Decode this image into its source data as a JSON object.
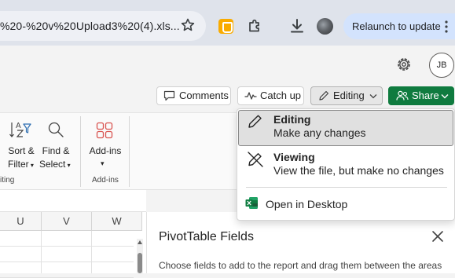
{
  "browser": {
    "address_text": "%20-%20v%20Upload3%20(4).xls...",
    "relaunch_label": "Relaunch to update",
    "icons": [
      "star-icon",
      "extension-icon",
      "puzzle-icon",
      "download-icon",
      "profile-avatar",
      "more-icon"
    ]
  },
  "header": {
    "avatar_initials": "JB",
    "comments_label": "Comments",
    "catchup_label": "Catch up",
    "editing_label": "Editing",
    "share_label": "Share"
  },
  "ribbon": {
    "sort_label_1": "Sort &",
    "sort_label_2": "Filter",
    "find_label_1": "Find &",
    "find_label_2": "Select",
    "editing_group": "iting",
    "addins_label": "Add-ins",
    "addins_group": "Add-ins"
  },
  "sheet": {
    "columns": [
      "U",
      "V",
      "W"
    ]
  },
  "pivot": {
    "title": "PivotTable Fields",
    "description": "Choose fields to add to the report and drag them between the areas"
  },
  "menu": {
    "editing_title": "Editing",
    "editing_desc": "Make any changes",
    "viewing_title": "Viewing",
    "viewing_desc": "View the file, but make no changes",
    "open_desktop": "Open in Desktop"
  },
  "colors": {
    "share_green": "#0f7b3f",
    "relaunch_bg": "#d3e3fd",
    "excel_green": "#107c41"
  }
}
